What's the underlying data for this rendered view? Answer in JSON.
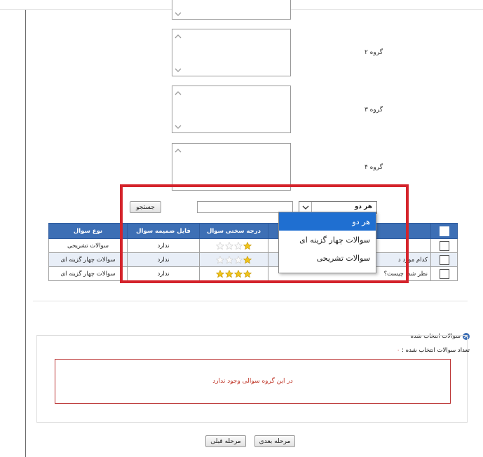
{
  "groups": [
    {
      "label": "گروه ۲"
    },
    {
      "label": "گروه ۳"
    },
    {
      "label": "گروه ۴"
    }
  ],
  "search": {
    "button_label": "جستجو",
    "input_value": "",
    "type_select_value": "هر دو"
  },
  "dropdown": {
    "options": [
      "هر دو",
      "سوالات چهار گزینه ای",
      "سوالات تشریحی"
    ],
    "selected_index": 0
  },
  "table": {
    "headers": {
      "type": "نوع سوال",
      "attachment": "فایل ضمیمه سوال",
      "difficulty": "درجه سختی سوال"
    },
    "rows": [
      {
        "type": "سوالات تشریحی",
        "attachment": "ندارد",
        "stars": 1,
        "question": ""
      },
      {
        "type": "سوالات چهار گزینه ای",
        "attachment": "ندارد",
        "stars": 1,
        "question": "کدام مورد د"
      },
      {
        "type": "سوالات چهار گزینه ای",
        "attachment": "ندارد",
        "stars": 4,
        "question": "نظر شما چیست؟"
      }
    ]
  },
  "selected": {
    "title": "سوالات انتخاب شده",
    "count_label": "تعداد سوالات انتخاب شده :",
    "count_value": "۰",
    "empty_message": "در این گروه سوالی وجود ندارد"
  },
  "nav": {
    "next_label": "مرحله بعدی",
    "prev_label": "مرحله قبلی"
  },
  "colors": {
    "header_blue": "#3d6fb5",
    "highlight_red": "#d4232b",
    "star_gold": "#f0c419"
  }
}
